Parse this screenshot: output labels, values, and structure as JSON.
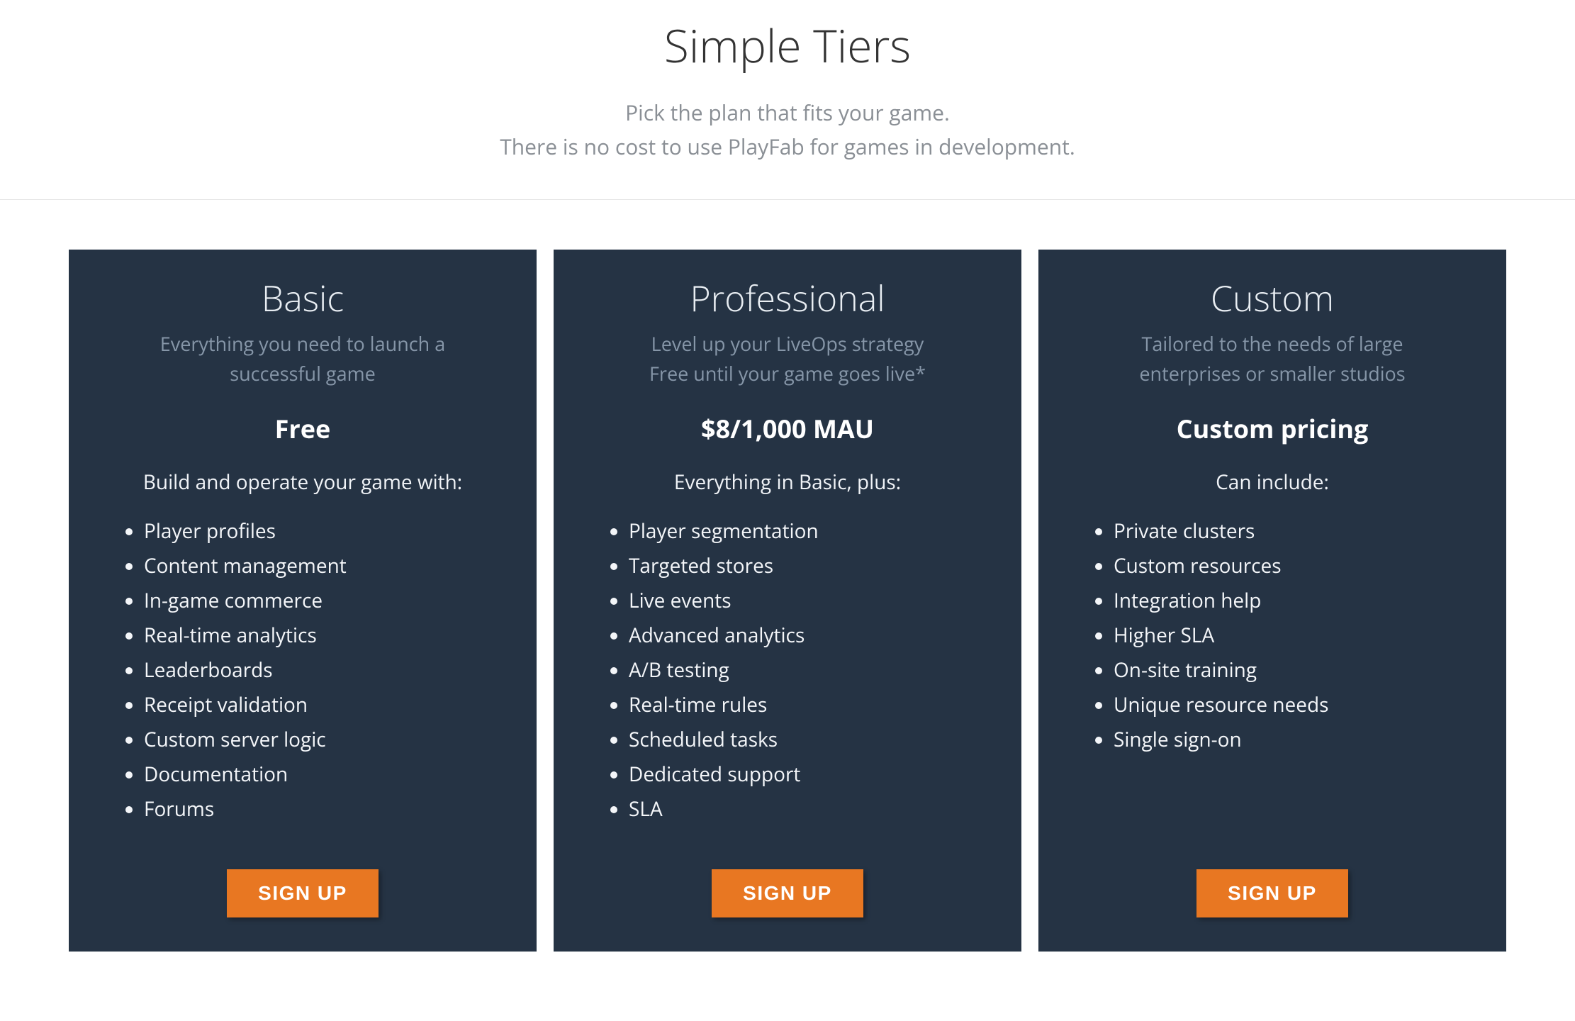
{
  "header": {
    "title": "Simple Tiers",
    "subtitle_line1": "Pick the plan that fits your game.",
    "subtitle_line2": "There is no cost to use PlayFab for games in development."
  },
  "plans": [
    {
      "name": "Basic",
      "tagline_line1": "Everything you need to launch a",
      "tagline_line2": "successful game",
      "price": "Free",
      "includes": "Build and operate your game with:",
      "features": [
        "Player profiles",
        "Content management",
        "In-game commerce",
        "Real-time analytics",
        "Leaderboards",
        "Receipt validation",
        "Custom server logic",
        "Documentation",
        "Forums"
      ],
      "cta": "SIGN UP"
    },
    {
      "name": "Professional",
      "tagline_line1": "Level up your LiveOps strategy",
      "tagline_line2": "Free until your game goes live*",
      "price": "$8/1,000 MAU",
      "includes": "Everything in Basic, plus:",
      "features": [
        "Player segmentation",
        "Targeted stores",
        "Live events",
        "Advanced analytics",
        "A/B testing",
        "Real-time rules",
        "Scheduled tasks",
        "Dedicated support",
        "SLA"
      ],
      "cta": "SIGN UP"
    },
    {
      "name": "Custom",
      "tagline_line1": "Tailored to the needs of large",
      "tagline_line2": "enterprises or smaller studios",
      "price": "Custom pricing",
      "includes": "Can include:",
      "features": [
        "Private clusters",
        "Custom resources",
        "Integration help",
        "Higher SLA",
        "On-site training",
        "Unique resource needs",
        "Single sign-on"
      ],
      "cta": "SIGN UP"
    }
  ]
}
